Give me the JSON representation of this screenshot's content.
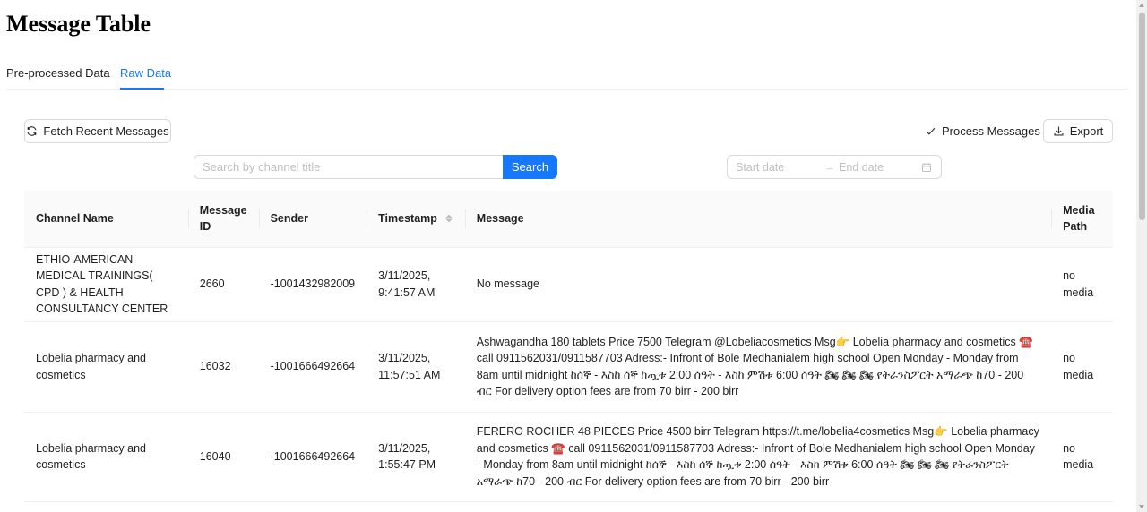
{
  "page": {
    "title": "Message Table"
  },
  "tabs": [
    {
      "label": "Pre-processed Data",
      "active": false
    },
    {
      "label": "Raw Data",
      "active": true
    }
  ],
  "toolbar": {
    "fetch_label": "Fetch Recent Messages",
    "process_label": "Process Messages",
    "export_label": "Export"
  },
  "search": {
    "placeholder": "Search by channel title",
    "button_label": "Search",
    "value": ""
  },
  "date_range": {
    "start_placeholder": "Start date",
    "end_placeholder": "End date"
  },
  "table": {
    "columns": [
      "Channel Name",
      "Message ID",
      "Sender",
      "Timestamp",
      "Message",
      "Media Path"
    ],
    "rows": [
      {
        "channel": "ETHIO-AMERICAN MEDICAL TRAININGS( CPD ) & HEALTH CONSULTANCY CENTER",
        "message_id": "2660",
        "sender": "-1001432982009",
        "timestamp": "3/11/2025, 9:41:57 AM",
        "message": "No message",
        "media": "no media"
      },
      {
        "channel": "Lobelia pharmacy and cosmetics",
        "message_id": "16032",
        "sender": "-1001666492664",
        "timestamp": "3/11/2025, 11:57:51 AM",
        "message": "Ashwagandha 180 tablets Price 7500 Telegram @Lobeliacosmetics Msg👉 Lobelia pharmacy and cosmetics ☎️ call 0911562031/0911587703 Adress:- Infront of Bole Medhanialem high school Open Monday - Monday from 8am until midnight ከሰኞ - እስከ ሰኞ ከጧቱ 2:00 ሰዓት - እስከ ምሽቱ 6:00 ሰዓት 🏍 🏍 🏍 የትራንስፖርት አማራጭ ከ70 - 200 ብር For delivery option fees are from 70 birr - 200 birr",
        "media": "no media"
      },
      {
        "channel": "Lobelia pharmacy and cosmetics",
        "message_id": "16040",
        "sender": "-1001666492664",
        "timestamp": "3/11/2025, 1:55:47 PM",
        "message": "FERERO ROCHER 48 PIECES Price 4500 birr Telegram https://t.me/lobelia4cosmetics Msg👉 Lobelia pharmacy and cosmetics ☎️ call 0911562031/0911587703 Adress:- Infront of Bole Medhanialem high school Open Monday - Monday from 8am until midnight ከሰኞ - እስከ ሰኞ ከጧቱ 2:00 ሰዓት - እስከ ምሽቱ 6:00 ሰዓት 🏍 🏍 🏍 የትራንስፖርት አማራጭ ከ70 - 200 ብር For delivery option fees are from 70 birr - 200 birr",
        "media": "no media"
      }
    ]
  },
  "colors": {
    "accent": "#1677ff",
    "border": "#d9d9d9",
    "header_bg": "#fafafa"
  },
  "icons": [
    "reload-icon",
    "check-icon",
    "download-icon",
    "calendar-icon",
    "arrow-right-icon",
    "sort-icon"
  ]
}
